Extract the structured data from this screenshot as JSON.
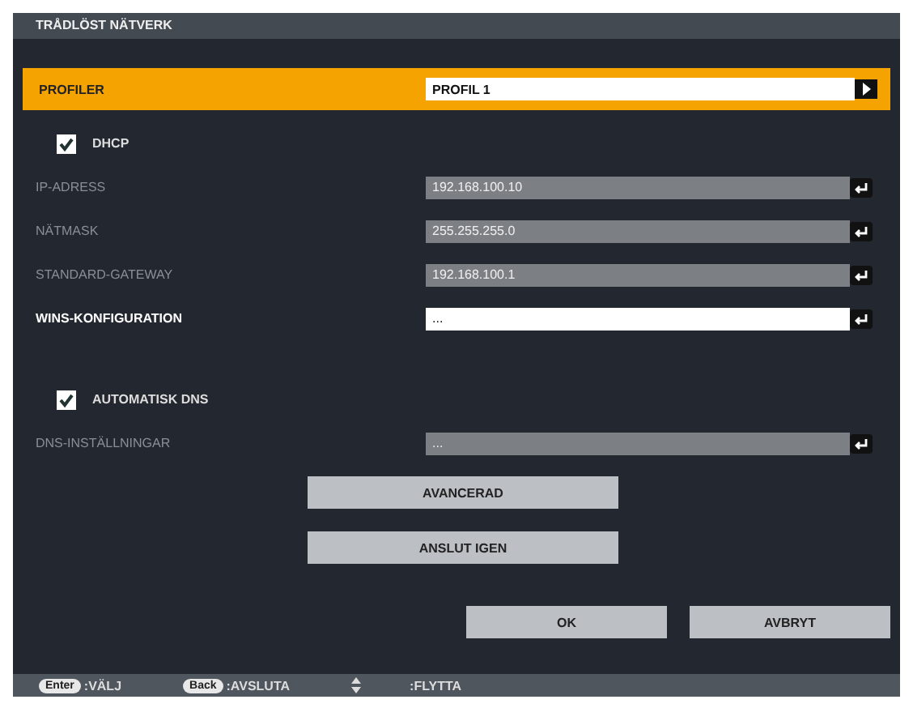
{
  "window": {
    "title": "TRÅDLÖST NÄTVERK"
  },
  "profile": {
    "label": "PROFILER",
    "value": "PROFIL 1"
  },
  "rows": [
    {
      "kind": "checkbox",
      "label": "DHCP",
      "checked": true
    },
    {
      "kind": "field",
      "label": "IP-ADRESS",
      "value": "192.168.100.10",
      "disabled": true
    },
    {
      "kind": "field",
      "label": "NÄTMASK",
      "value": "255.255.255.0",
      "disabled": true
    },
    {
      "kind": "field",
      "label": "STANDARD-GATEWAY",
      "value": "192.168.100.1",
      "disabled": true
    },
    {
      "kind": "field",
      "label": "WINS-KONFIGURATION",
      "value": "...",
      "disabled": false
    },
    {
      "kind": "checkbox",
      "label": "AUTOMATISK DNS",
      "checked": true
    },
    {
      "kind": "field",
      "label": "DNS-INSTÄLLNINGAR",
      "value": "...",
      "disabled": true
    }
  ],
  "center_buttons": [
    "AVANCERAD",
    "ANSLUT IGEN"
  ],
  "dialog_buttons": [
    "OK",
    "AVBRYT"
  ],
  "footer": [
    {
      "kind": "key",
      "key": "Enter",
      "text": ":VÄLJ"
    },
    {
      "kind": "key",
      "key": "Back",
      "text": ":AVSLUTA"
    },
    {
      "kind": "arrows",
      "text": ":FLYTTA"
    }
  ]
}
